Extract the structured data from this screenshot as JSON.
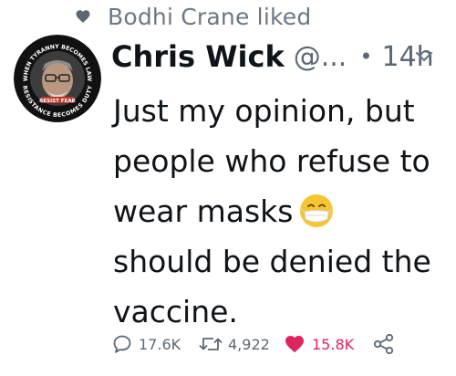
{
  "activity": {
    "liked_by_text": "Bodhi Crane liked",
    "icon": "heart-icon"
  },
  "tweet": {
    "author_name": "Chris Wick",
    "handle": "@...",
    "separator": "•",
    "time": "14h",
    "text_lines": [
      "Just my opinion, but",
      "people who refuse to",
      "wear masks",
      "should be denied the",
      "vaccine."
    ],
    "emoji": "face-with-medical-mask",
    "avatar_badge_text_top": "WHEN TYRANNY BECOMES LAW",
    "avatar_badge_text_bottom": "RESISTANCE BECOMES DUTY",
    "avatar_badge_center": "RESIST FEAR"
  },
  "actions": {
    "reply_count": "17.6K",
    "retweet_count": "4,922",
    "like_count": "15.8K",
    "like_color": "#e0245e",
    "icons": [
      "reply-icon",
      "retweet-icon",
      "like-heart-icon",
      "share-icon"
    ]
  },
  "colors": {
    "meta_gray": "#5b6874",
    "text": "#0f1419",
    "like_red": "#e0245e"
  }
}
